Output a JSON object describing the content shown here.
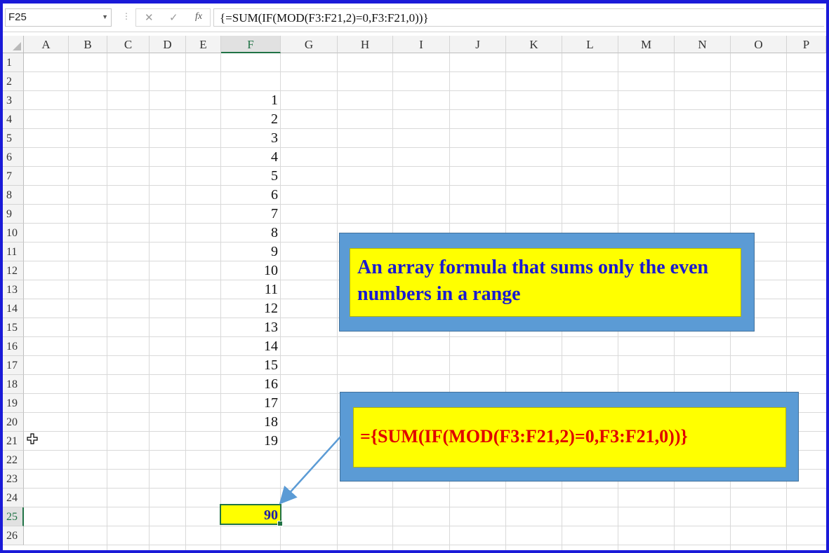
{
  "formula_bar": {
    "name_box": "F25",
    "cancel_icon": "✕",
    "enter_icon": "✓",
    "fx_label": "fx",
    "formula": "{=SUM(IF(MOD(F3:F21,2)=0,F3:F21,0))}"
  },
  "columns": [
    "A",
    "B",
    "C",
    "D",
    "E",
    "F",
    "G",
    "H",
    "I",
    "J",
    "K",
    "L",
    "M",
    "N",
    "O",
    "P"
  ],
  "selected_column": "F",
  "rows": [
    "1",
    "2",
    "3",
    "4",
    "5",
    "6",
    "7",
    "8",
    "9",
    "10",
    "11",
    "12",
    "13",
    "14",
    "15",
    "16",
    "17",
    "18",
    "19",
    "20",
    "21",
    "22",
    "23",
    "24",
    "25",
    "26"
  ],
  "selected_row": "25",
  "column_f_values": [
    "1",
    "2",
    "3",
    "4",
    "5",
    "6",
    "7",
    "8",
    "9",
    "10",
    "11",
    "12",
    "13",
    "14",
    "15",
    "16",
    "17",
    "18",
    "19"
  ],
  "result_cell": {
    "ref": "F25",
    "value": "90",
    "fill": "#ffff00",
    "text_color": "#1f1fa8"
  },
  "callout_description": {
    "text": "An array formula that sums only the even numbers in a range",
    "box_color": "#5b9bd5",
    "fill": "#ffff00",
    "text_color": "#1a1ad0"
  },
  "callout_formula": {
    "text": "={SUM(IF(MOD(F3:F21,2)=0,F3:F21,0))}",
    "text_color": "#e00000"
  },
  "colors": {
    "frame": "#1a1ad8",
    "selection": "#217346",
    "gridline": "#d9d9d9"
  }
}
